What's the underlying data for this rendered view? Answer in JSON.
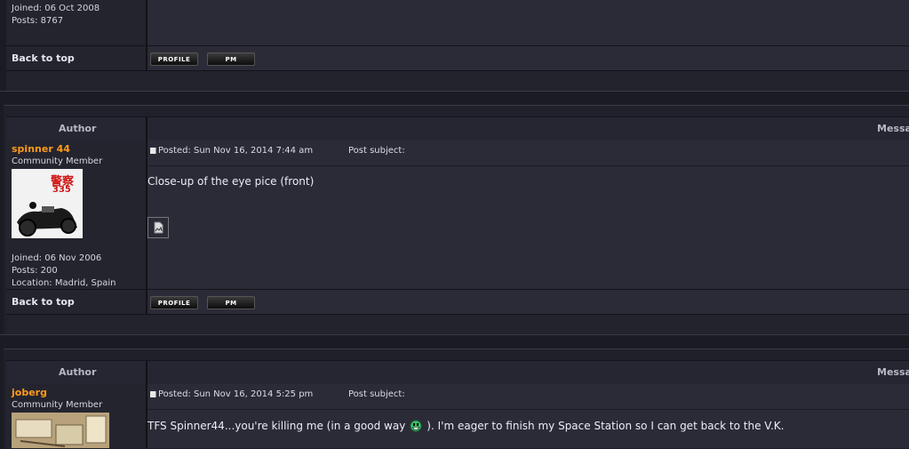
{
  "common": {
    "back_to_top": "Back to top",
    "profile_button": "PROFILE",
    "pm_button": "PM",
    "author_header": "Author",
    "message_header": "Messa"
  },
  "post_top": {
    "joined": "Joined: 06 Oct 2008",
    "posts": "Posts: 8767"
  },
  "post_spinner": {
    "username": "spinner 44",
    "rank": "Community Member",
    "avatar_text_top": "警察",
    "avatar_text_bottom": "335",
    "joined": "Joined: 06 Nov 2006",
    "posts": "Posts: 200",
    "location": "Location: Madrid, Spain",
    "posted": "Posted: Sun Nov 16, 2014 7:44 am",
    "subject": "Post subject:",
    "message": "Close-up of the eye pice (front)"
  },
  "post_joberg": {
    "username": "joberg",
    "rank": "Community Member",
    "posted": "Posted: Sun Nov 16, 2014 5:25 pm",
    "subject": "Post subject:",
    "message_before": "TFS Spinner44...you're killing me (in a good way",
    "message_after": "). I'm eager to finish my Space Station so I can get back to the V.K."
  }
}
